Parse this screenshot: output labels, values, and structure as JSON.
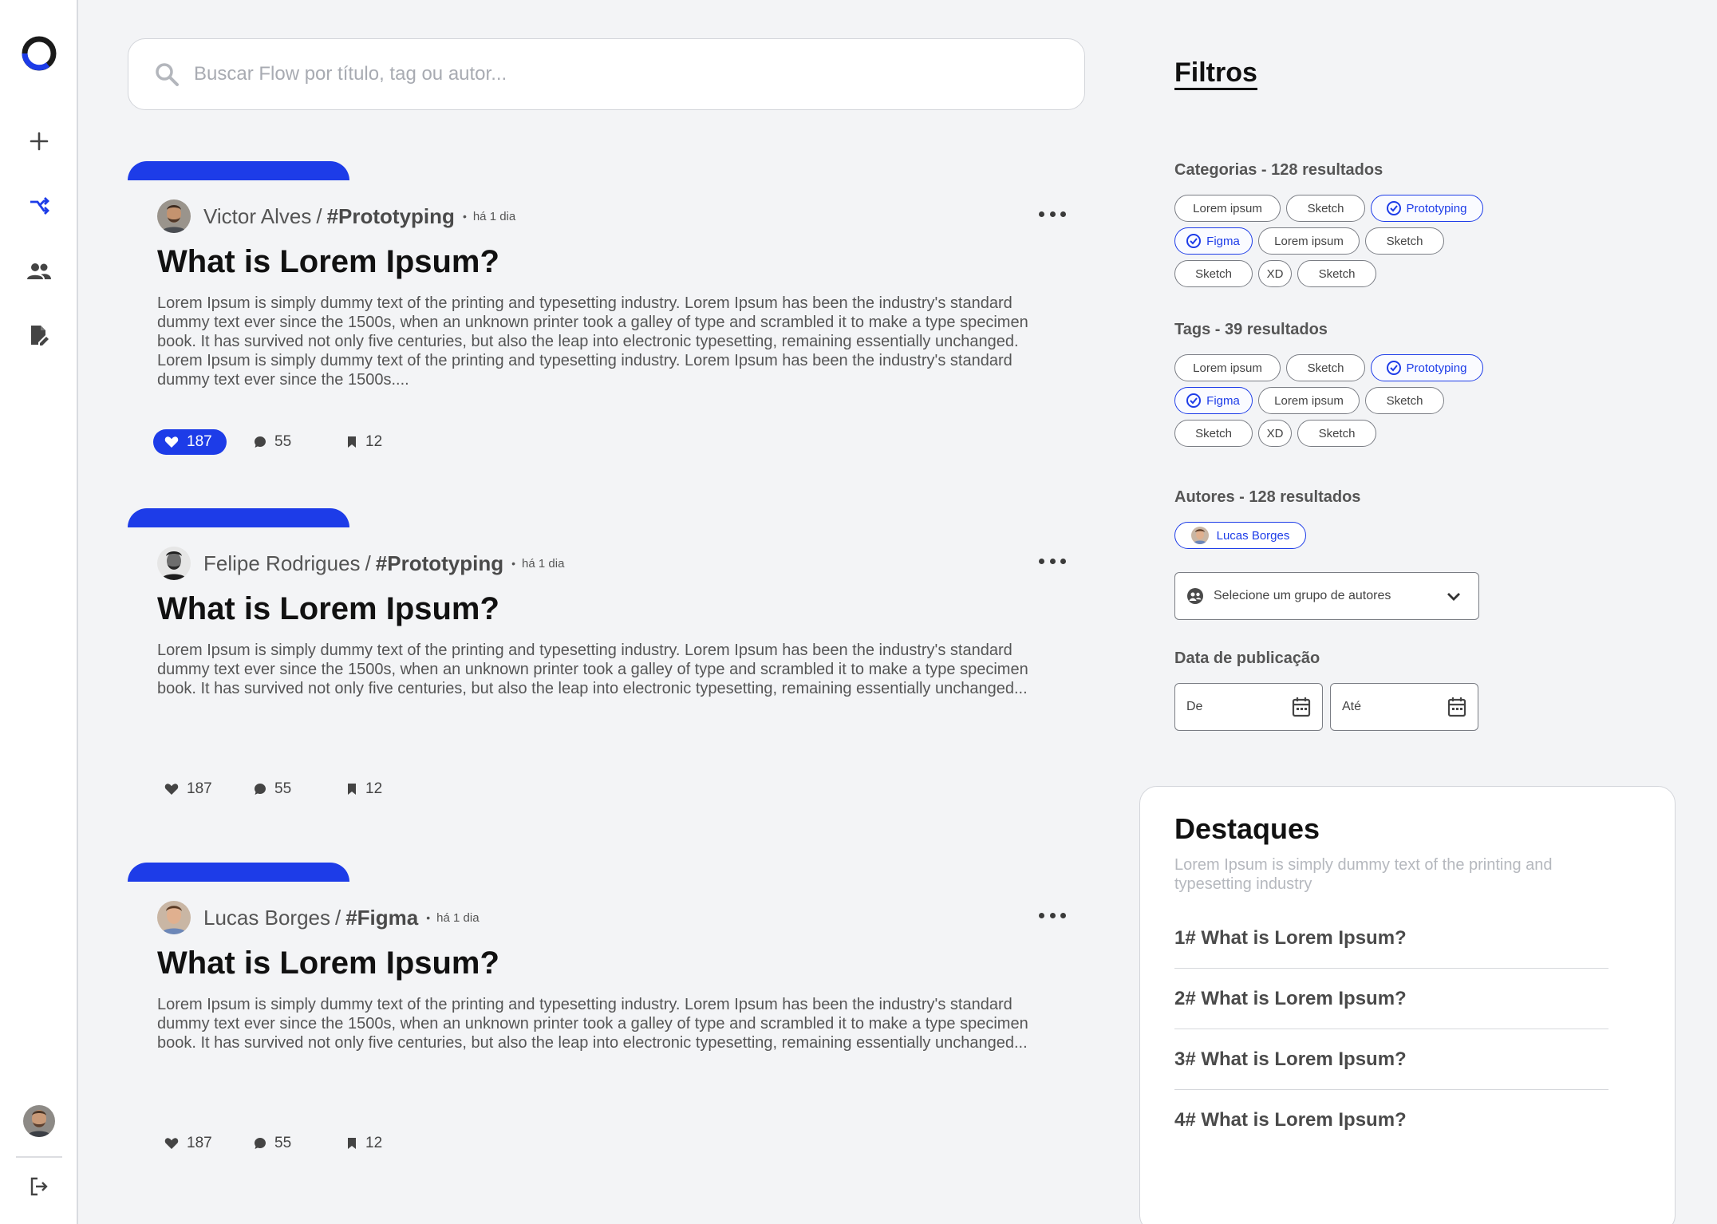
{
  "sidebar": {
    "logo": "ring-logo",
    "items": [
      {
        "name": "plus-icon"
      },
      {
        "name": "flows-icon",
        "active": true
      },
      {
        "name": "people-icon"
      },
      {
        "name": "edit-document-icon"
      }
    ],
    "logout": "logout-icon"
  },
  "search": {
    "placeholder": "Buscar Flow por título, tag ou autor...",
    "value": ""
  },
  "posts": [
    {
      "author": "Victor Alves",
      "topic": "#Prototyping",
      "time": "há 1 dia",
      "title": "What is Lorem Ipsum?",
      "body": "Lorem Ipsum is simply dummy text of the printing and typesetting industry. Lorem Ipsum has been the industry's standard dummy text ever since the 1500s, when an unknown printer took a galley of type and scrambled it to make a type specimen book. It has survived not only five centuries, but also the leap into electronic typesetting, remaining essentially unchanged. Lorem Ipsum is simply dummy text of the printing and typesetting industry. Lorem Ipsum has been the industry's standard dummy text ever since the 1500s....",
      "likes": "187",
      "comments": "55",
      "saves": "12",
      "liked": true
    },
    {
      "author": "Felipe Rodrigues",
      "topic": "#Prototyping",
      "time": "há 1 dia",
      "title": "What is Lorem Ipsum?",
      "body": "Lorem Ipsum is simply dummy text of the printing and typesetting industry. Lorem Ipsum has been the industry's standard dummy text ever since the 1500s, when an unknown printer took a galley of type and scrambled it to make a type specimen book. It has survived not only five centuries, but also the leap into electronic typesetting, remaining essentially unchanged...",
      "likes": "187",
      "comments": "55",
      "saves": "12",
      "liked": false
    },
    {
      "author": "Lucas Borges",
      "topic": "#Figma",
      "time": "há 1 dia",
      "title": "What is Lorem Ipsum?",
      "body": "Lorem Ipsum is simply dummy text of the printing and typesetting industry. Lorem Ipsum has been the industry's standard dummy text ever since the 1500s, when an unknown printer took a galley of type and scrambled it to make a type specimen book. It has survived not only five centuries, but also the leap into electronic typesetting, remaining essentially unchanged...",
      "likes": "187",
      "comments": "55",
      "saves": "12",
      "liked": false
    }
  ],
  "filters": {
    "title": "Filtros",
    "categories": {
      "label": "Categorias - 128 resultados",
      "rows": [
        [
          {
            "text": "Lorem ipsum"
          },
          {
            "text": "Sketch"
          },
          {
            "text": "Prototyping",
            "selected": true
          }
        ],
        [
          {
            "text": "Figma",
            "selected": true
          },
          {
            "text": "Lorem ipsum"
          },
          {
            "text": "Sketch"
          }
        ],
        [
          {
            "text": "Sketch"
          },
          {
            "text": "XD"
          },
          {
            "text": "Sketch"
          }
        ]
      ]
    },
    "tags": {
      "label": "Tags - 39 resultados",
      "rows": [
        [
          {
            "text": "Lorem ipsum"
          },
          {
            "text": "Sketch"
          },
          {
            "text": "Prototyping",
            "selected": true
          }
        ],
        [
          {
            "text": "Figma",
            "selected": true
          },
          {
            "text": "Lorem ipsum"
          },
          {
            "text": "Sketch"
          }
        ],
        [
          {
            "text": "Sketch"
          },
          {
            "text": "XD"
          },
          {
            "text": "Sketch"
          }
        ]
      ]
    },
    "authors": {
      "label": "Autores - 128 resultados",
      "selected": "Lucas Borges",
      "group_select": "Selecione um grupo de autores"
    },
    "date": {
      "label": "Data de publicação",
      "from": "De",
      "to": "Até"
    }
  },
  "highlights": {
    "title": "Destaques",
    "subtitle": "Lorem Ipsum is simply dummy text of the printing and typesetting industry",
    "items": [
      "1# What is Lorem Ipsum?",
      "2# What is Lorem Ipsum?",
      "3# What is Lorem Ipsum?",
      "4# What is Lorem Ipsum?"
    ]
  },
  "colors": {
    "accent": "#1d3ce8",
    "background": "#f3f4f6",
    "text": "#555555"
  }
}
